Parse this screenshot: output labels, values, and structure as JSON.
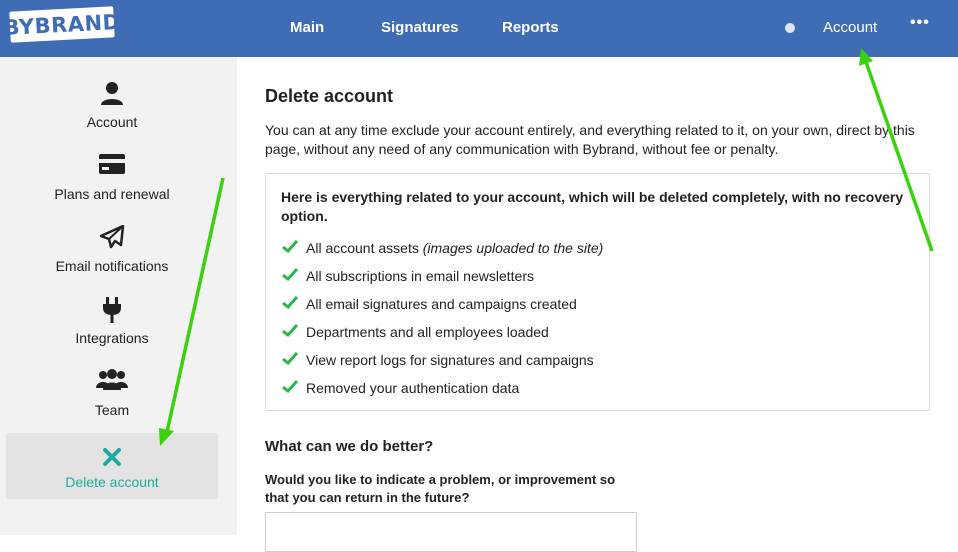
{
  "header": {
    "logo_text": "BYBRAND",
    "nav": [
      "Main",
      "Signatures",
      "Reports"
    ],
    "account_label": "Account",
    "more_label": "•••"
  },
  "sidebar": {
    "items": [
      {
        "label": "Account",
        "icon": "user-icon"
      },
      {
        "label": "Plans and renewal",
        "icon": "credit-card-icon"
      },
      {
        "label": "Email notifications",
        "icon": "paper-plane-icon"
      },
      {
        "label": "Integrations",
        "icon": "plug-icon"
      },
      {
        "label": "Team",
        "icon": "users-icon"
      },
      {
        "label": "Delete account",
        "icon": "close-icon",
        "active": true
      }
    ]
  },
  "main": {
    "title": "Delete account",
    "intro": "You can at any time exclude your account entirely, and everything related to it, on your own, direct by this page, without any need of any communication with Bybrand, without fee or penalty.",
    "panel_heading": "Here is everything related to your account, which will be deleted completely, with no recovery option.",
    "items": [
      {
        "text": "All account assets",
        "note": "(images uploaded to the site)"
      },
      {
        "text": "All subscriptions in email newsletters",
        "note": ""
      },
      {
        "text": "All email signatures and campaigns created",
        "note": ""
      },
      {
        "text": "Departments and all employees loaded",
        "note": ""
      },
      {
        "text": "View report logs for signatures and campaigns",
        "note": ""
      },
      {
        "text": "Removed your authentication data",
        "note": ""
      }
    ],
    "feedback_title": "What can we do better?",
    "feedback_question": "Would you like to indicate a problem, or improvement so that you can return in the future?"
  },
  "colors": {
    "header": "#3f6db5",
    "accent": "#1eaaa0",
    "check": "#2cb34a",
    "annotation_arrow": "#3ad20f"
  }
}
